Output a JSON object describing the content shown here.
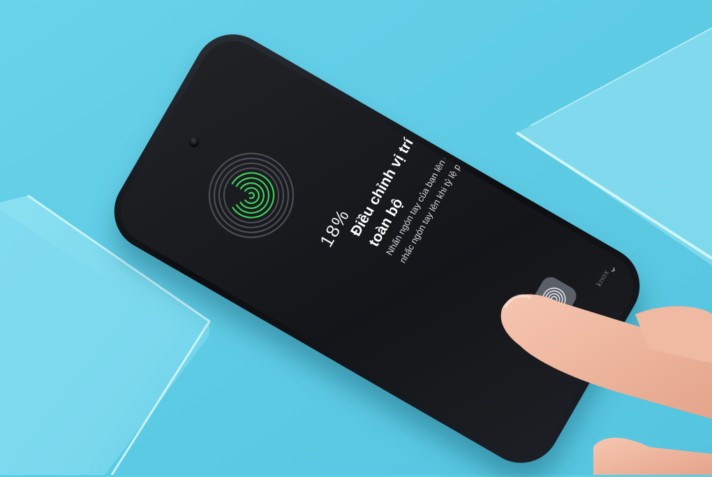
{
  "enroll": {
    "progress_text": "18%",
    "progress": 0.18,
    "title_line1": "Điều chỉnh vị trí ngón tay để quét",
    "title_line2": "toàn bộ",
    "desc_line1": "Nhấn ngón tay của bạn lên cảm biến, sau đó",
    "desc_line2": "nhấc ngón tay lên khi tỷ lệ phần trăm tăng lên.",
    "badge": "knox",
    "collapse_icon": "chevron-down-icon",
    "sensor_icon": "fingerprint-icon",
    "accent_color": "#3ed15a"
  },
  "scene": {
    "background_color": "#5fcde6"
  }
}
